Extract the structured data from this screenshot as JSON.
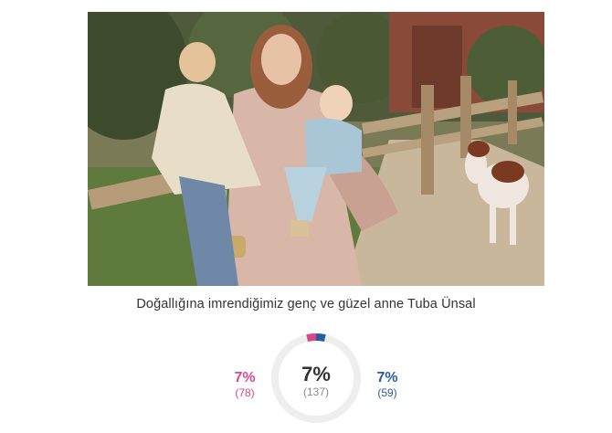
{
  "photo": {
    "caption": "Doğallığına imrendiğimiz genç ve güzel anne Tuba Ünsal"
  },
  "stats": {
    "female": {
      "percent": "7%",
      "count": "(78)",
      "color": "#d6498b",
      "share": 0.07
    },
    "total": {
      "percent": "7%",
      "count": "(137)"
    },
    "male": {
      "percent": "7%",
      "count": "(59)",
      "color": "#2a5d9c",
      "share": 0.07
    }
  }
}
